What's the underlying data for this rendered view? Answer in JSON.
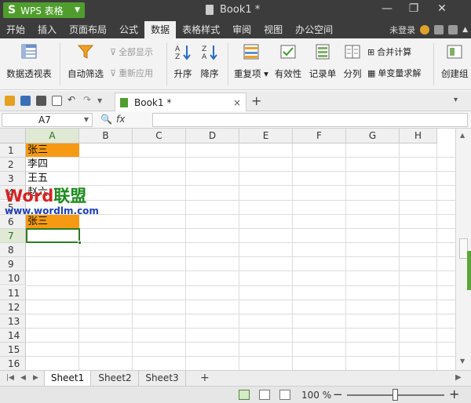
{
  "app": {
    "name": "WPS 表格",
    "doc_title": "Book1 *"
  },
  "menu": {
    "tabs": [
      "开始",
      "插入",
      "页面布局",
      "公式",
      "数据",
      "表格样式",
      "审阅",
      "视图",
      "办公空间"
    ],
    "active": "数据",
    "login": "未登录"
  },
  "ribbon": {
    "pivot": "数据透视表",
    "autofilter": "自动筛选",
    "show_all": "全部显示",
    "reapply": "重新应用",
    "sort_asc": "升序",
    "sort_desc": "降序",
    "duplicates": "重复项",
    "validity": "有效性",
    "record_form": "记录单",
    "split": "分列",
    "consolidate": "合并计算",
    "single_var": "单变量求解",
    "create_group": "创建组"
  },
  "doc_tab": {
    "label": "Book1 *",
    "close": "×",
    "add": "+"
  },
  "formula_bar": {
    "name_box": "A7",
    "fx": "fx",
    "formula": ""
  },
  "grid": {
    "columns": [
      "A",
      "B",
      "C",
      "D",
      "E",
      "F",
      "G",
      "H"
    ],
    "selected_column": "A",
    "rows": [
      "1",
      "2",
      "3",
      "4",
      "5",
      "6",
      "7",
      "8",
      "9",
      "10",
      "11",
      "12",
      "13",
      "14",
      "15",
      "16"
    ],
    "selected_row": "7",
    "cells_A": [
      "张三",
      "李四",
      "王五",
      "赵六",
      "",
      "张三",
      "",
      "",
      "",
      "",
      "",
      "",
      "",
      "",
      "",
      ""
    ],
    "highlight_color": "#f59a12"
  },
  "watermark": {
    "brand_part1": "Word",
    "brand_part2": "联盟",
    "url": "www.wordlm.com",
    "color1": "#d62222",
    "color2": "#1c8a1c"
  },
  "sheets": {
    "tabs": [
      "Sheet1",
      "Sheet2",
      "Sheet3"
    ],
    "active": "Sheet1",
    "add": "+"
  },
  "status": {
    "zoom": "100 %",
    "zoom_fraction": 0.5
  }
}
